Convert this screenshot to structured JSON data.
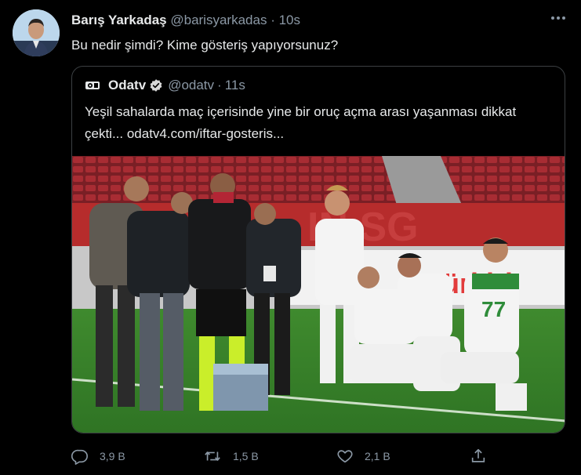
{
  "tweet": {
    "author_name": "Barış Yarkadaş",
    "author_handle": "@barisyarkadas",
    "separator": "·",
    "time": "10s",
    "text": "Bu nedir şimdi? Kime gösteriş yapıyorsunuz?",
    "more_icon": "more-icon",
    "avatar_icon": "avatar"
  },
  "quote": {
    "author_name": "Odatv",
    "author_handle": "@odatv",
    "separator": "·",
    "time": "11s",
    "text": "Yeşil sahalarda maç içerisinde yine bir oruç açma arası yaşanması dikkat çekti... odatv4.com/iftar-gosteris...",
    "verified_icon": "verified-badge-icon",
    "logo_icon": "odatv-logo-icon",
    "verified_color": "#d9d9d9"
  },
  "actions": {
    "reply_count": "3,9 B",
    "retweet_count": "1,5 B",
    "like_count": "2,1 B",
    "reply_icon": "reply-icon",
    "retweet_icon": "retweet-icon",
    "like_icon": "heart-icon",
    "share_icon": "share-icon"
  },
  "colors": {
    "background": "#000000",
    "secondary_text": "#8b98a5",
    "primary_text": "#e7e9ea",
    "border": "#3c4043"
  }
}
